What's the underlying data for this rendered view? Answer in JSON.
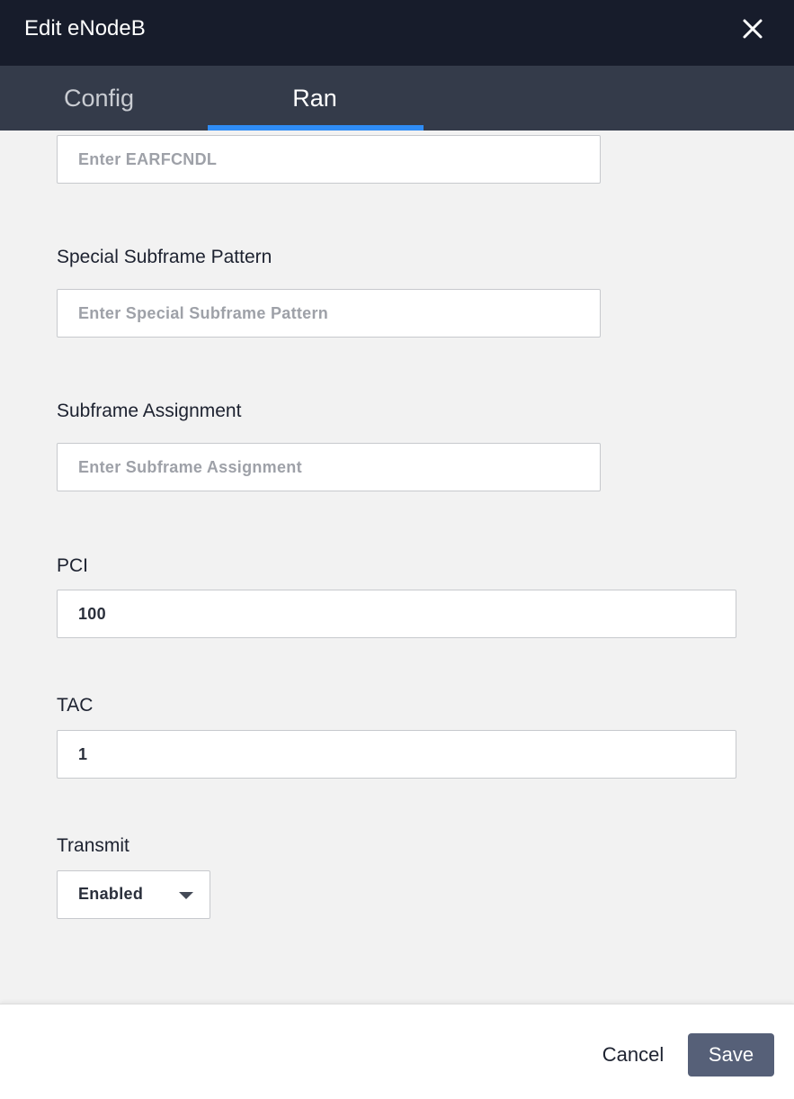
{
  "dialog": {
    "title": "Edit eNodeB"
  },
  "tabs": [
    {
      "label": "Config",
      "active": false
    },
    {
      "label": "Ran",
      "active": true
    }
  ],
  "colors": {
    "header_bg": "#171c2b",
    "tabbar_bg": "#343b4a",
    "tab_indicator": "#2f8cf5",
    "save_button_bg": "#566078"
  },
  "form": {
    "earfcndl": {
      "value": "",
      "placeholder": "Enter EARFCNDL"
    },
    "special_subframe_pattern": {
      "label": "Special Subframe Pattern",
      "value": "",
      "placeholder": "Enter Special Subframe Pattern"
    },
    "subframe_assignment": {
      "label": "Subframe Assignment",
      "value": "",
      "placeholder": "Enter Subframe Assignment"
    },
    "pci": {
      "label": "PCI",
      "value": "100"
    },
    "tac": {
      "label": "TAC",
      "value": "1"
    },
    "transmit": {
      "label": "Transmit",
      "selected": "Enabled"
    }
  },
  "footer": {
    "cancel_label": "Cancel",
    "save_label": "Save"
  },
  "icons": {
    "close": "close-icon",
    "dropdown": "caret-down-icon"
  }
}
